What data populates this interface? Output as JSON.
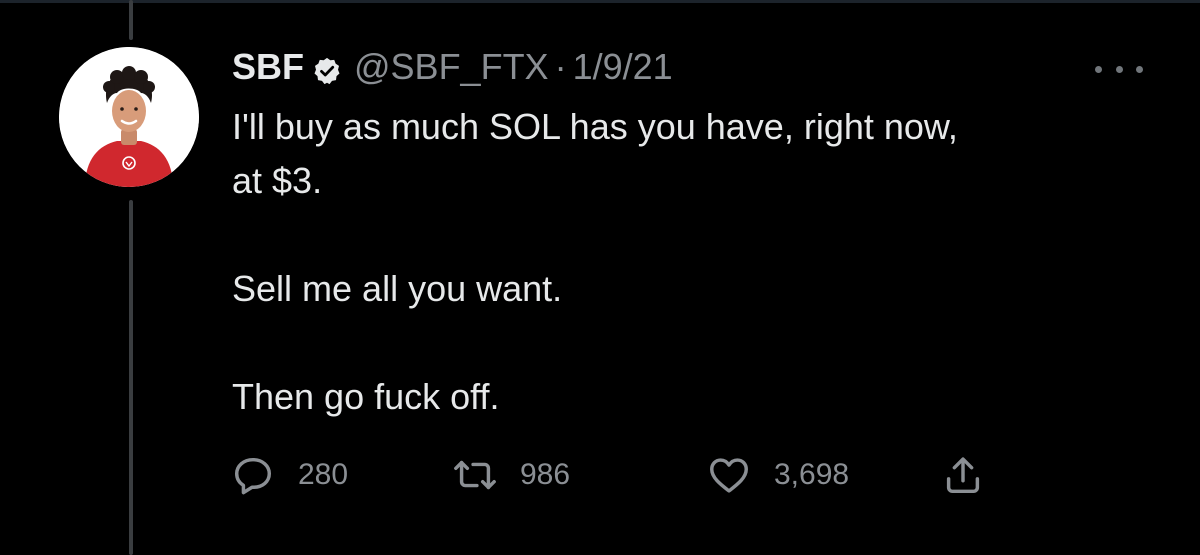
{
  "tweet": {
    "display_name": "SBF",
    "handle": "@SBF_FTX",
    "separator": "·",
    "date": "1/9/21",
    "lines": [
      "I'll buy as much SOL has you have, right now,",
      "at $3.",
      "Sell me all you want.",
      "Then go fuck off."
    ]
  },
  "metrics": {
    "replies": "280",
    "retweets": "986",
    "likes": "3,698"
  },
  "icons": {
    "verified": "verified-badge-icon",
    "more": "more-dots-icon",
    "reply": "reply-icon",
    "retweet": "retweet-icon",
    "like": "heart-icon",
    "share": "share-icon"
  },
  "colors": {
    "background": "#000000",
    "text": "#e7e9ea",
    "muted": "#8b8f94",
    "thread_line": "#3a3d40",
    "avatar_shirt": "#d0282e"
  }
}
